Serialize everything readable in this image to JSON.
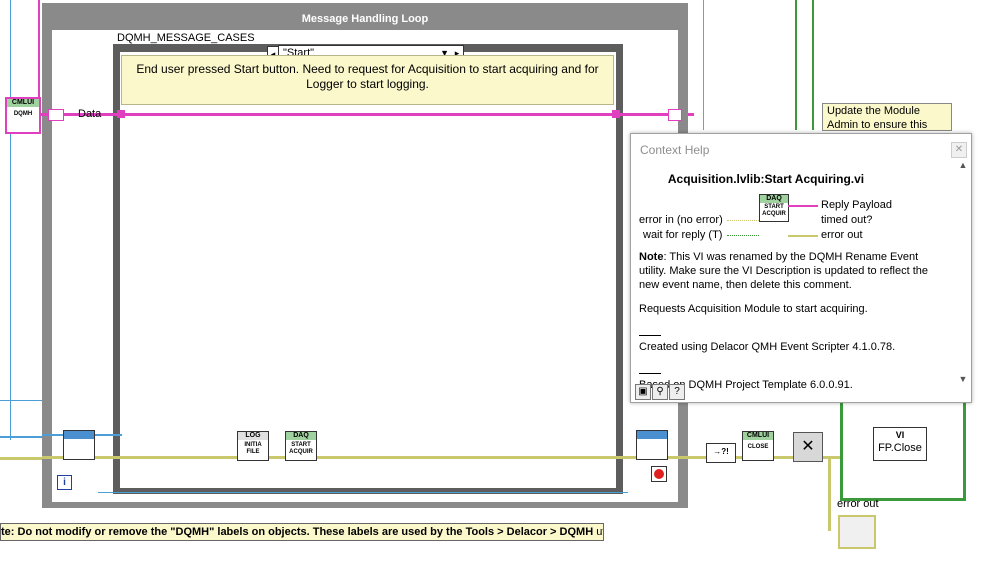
{
  "loop": {
    "title": "Message Handling Loop"
  },
  "case_structure": {
    "label": "DQMH_MESSAGE_CASES",
    "selector_value": "\"Start\"",
    "comment": "End user pressed Start button. Need to request for Acquisition to start acquiring and for Logger to start logging."
  },
  "wires": {
    "data_label": "Data"
  },
  "nodes": {
    "dqmh_cmlui": "CMLUI",
    "dqmh_sub": "DQMH",
    "log_header": "LOG",
    "log_text": "INITIA FILE",
    "daq_header": "DAQ",
    "daq_text": "START ACQUIR",
    "close_header": "CMLUI",
    "close_text": "CLOSE",
    "fp_header": "VI",
    "fp_close": "FP.Close",
    "error_out": "error out",
    "info_glyph": "i"
  },
  "update_note": "Update the Module Admin to ensure this",
  "context_help": {
    "title": "Context Help",
    "vi_name": "Acquisition.lvlib:Start Acquiring.vi",
    "terminals": {
      "error_in": "error in (no error)",
      "wait_for_reply": "wait for reply (T)",
      "reply_payload": "Reply Payload",
      "timed_out": "timed out?",
      "error_out": "error out"
    },
    "node_header": "DAQ",
    "node_text": "START ACQUIR",
    "note_label": "Note",
    "note_text": ": This VI was renamed by the DQMH Rename Event utility. Make sure the VI Description is updated to reflect the new event name, then delete this comment.",
    "desc": "Requests Acquisition Module to start acquiring.",
    "created": "Created using Delacor QMH Event Scripter 4.1.0.78.",
    "based": "Based on DQMH Project Template 6.0.0.91.",
    "buttons": [
      "lock",
      "link",
      "?"
    ]
  },
  "bottom_note": {
    "prefix": "te: Do not modify or remove the \"DQMH\" labels on objects. These labels are used by the ",
    "bold": "Tools > Delacor > DQMH",
    "suffix": " utilities."
  }
}
